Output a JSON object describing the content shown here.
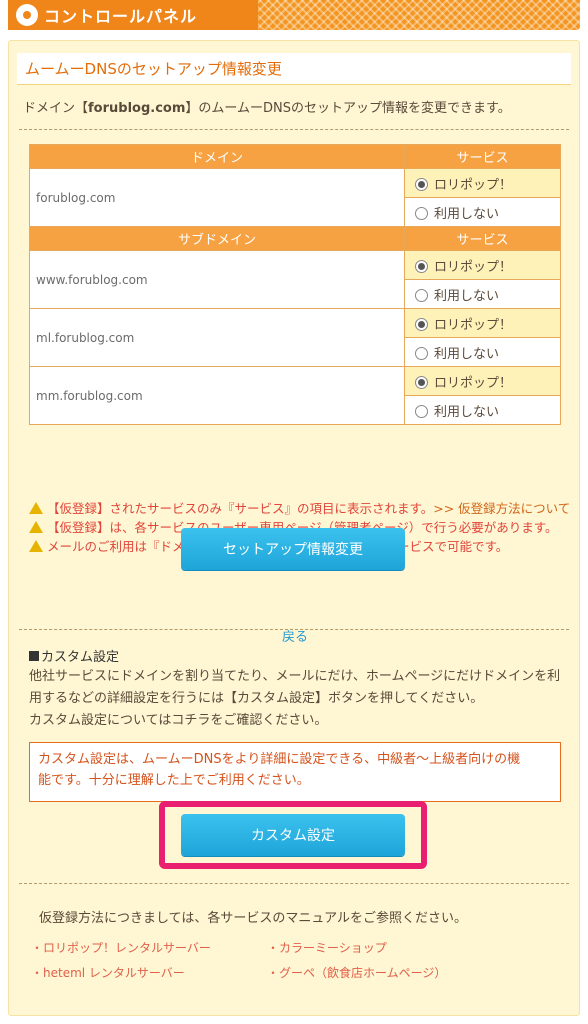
{
  "header": {
    "title": "コントロールパネル"
  },
  "section": {
    "title": "ムームーDNSのセットアップ情報変更",
    "intro_pre": "ドメイン【",
    "intro_domain": "forublog.com",
    "intro_post": "】のムームーDNSのセットアップ情報を変更できます。"
  },
  "table": {
    "domain_header": "ドメイン",
    "service_header": "サービス",
    "subdomain_header": "サブドメイン",
    "option_lolipop": "ロリポップ！",
    "option_none": "利用しない",
    "domain": "forublog.com",
    "subdomains": [
      "www.forublog.com",
      "ml.forublog.com",
      "mm.forublog.com"
    ]
  },
  "notes": {
    "note1": "【仮登録】されたサービスのみ『サービス』の項目に表示されます。",
    "note1_link": ">> 仮登録方法について",
    "note2": "【仮登録】は、各サービスのユーザー専用ページ（管理者ページ）で行う必要があります。",
    "note3": "メールのご利用は『ドメイン』の項目にセットアップされたサービスで可能です。"
  },
  "buttons": {
    "setup_change": "セットアップ情報変更",
    "back": "戻る",
    "custom": "カスタム設定"
  },
  "custom": {
    "heading": "カスタム設定",
    "desc1": "他社サービスにドメインを割り当てたり、メールにだけ、ホームページにだけドメインを利",
    "desc2": "用するなどの詳細設定を行うには【カスタム設定】ボタンを押してください。",
    "desc3": "カスタム設定についてはコチラをご確認ください。",
    "warning1": "カスタム設定は、ムームーDNSをより詳細に設定できる、中級者〜上級者向けの機",
    "warning2": "能です。十分に理解した上でご利用ください。"
  },
  "footer": {
    "text": "仮登録方法につきましては、各サービスのマニュアルをご参照ください。",
    "links": [
      "・ロリポップ！レンタルサーバー",
      "・カラーミーショップ",
      "・heteml レンタルサーバー",
      "・グーペ（飲食店ホームページ）"
    ]
  },
  "colors": {
    "orange": "#f7a242",
    "blue": "#1ea4d8",
    "highlight": "#e8206f"
  }
}
